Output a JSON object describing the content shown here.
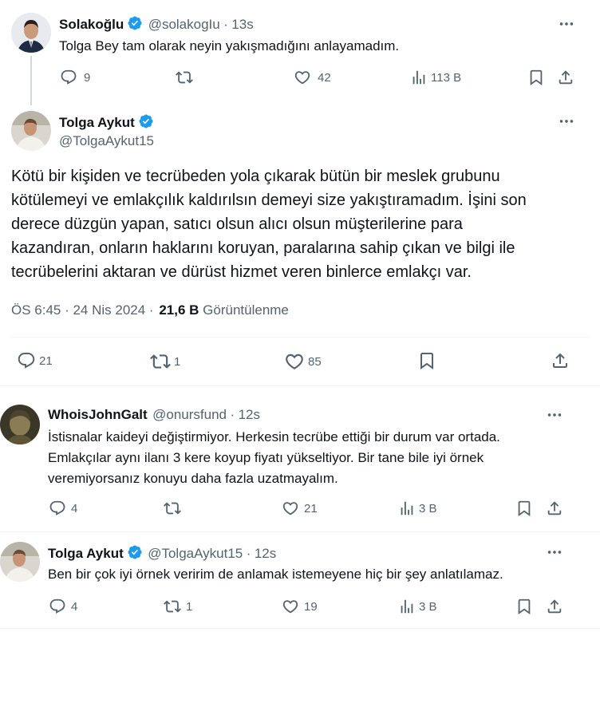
{
  "tweet1": {
    "name": "Solakoğlu",
    "handle": "@solakogIu",
    "sep": "·",
    "time": "13s",
    "text": "Tolga Bey tam olarak neyin yakışmadığını anlayamadım.",
    "replies": "9",
    "likes": "42",
    "views": "113 B"
  },
  "main": {
    "name": "Tolga Aykut",
    "handle": "@TolgaAykut15",
    "lines": [
      "Kötü bir kişiden ve tecrübeden yola çıkarak bütün bir meslek grubunu",
      "kötülemeyi ve emlakçılık kaldırılsın demeyi size yakıştıramadım. İşini son",
      "derece düzgün yapan, satıcı olsun alıcı olsun müşterilerine para",
      "kazandıran, onların haklarını koruyan, paralarına sahip çıkan ve bilgi ile",
      "tecrübelerini aktaran ve dürüst hizmet veren binlerce emlakçı var."
    ],
    "timestamp": "ÖS 6:45 · 24 Nis 2024 ·",
    "views_count": "21,6 B",
    "views_label": "Görüntülenme",
    "replies": "21",
    "retweets": "1",
    "likes": "85"
  },
  "reply1": {
    "name": "WhoisJohnGalt",
    "handle": "@onursfund",
    "sep": "·",
    "time": "12s",
    "lines": [
      "İstisnalar kaideyi değiştirmiyor. Herkesin tecrübe ettiği bir durum var ortada.",
      "Emlakçılar aynı ilanı 3 kere koyup fiyatı yükseltiyor. Bir tane bile iyi örnek",
      "veremiyorsanız konuyu daha fazla uzatmayalım."
    ],
    "replies": "4",
    "likes": "21",
    "views": "3 B"
  },
  "reply2": {
    "name": "Tolga Aykut",
    "handle": "@TolgaAykut15",
    "sep": "·",
    "time": "12s",
    "text": "Ben bir çok iyi örnek veririm de anlamak istemeyene hiç bir şey anlatılamaz.",
    "replies": "4",
    "retweets": "1",
    "likes": "19",
    "views": "3 B"
  },
  "icons": [
    "more-icon",
    "verified-badge-icon",
    "reply-icon",
    "retweet-icon",
    "like-icon",
    "views-icon",
    "bookmark-icon",
    "share-icon"
  ],
  "colors": {
    "verified": "#1d9bf0",
    "muted": "#536471",
    "text": "#0f1419"
  }
}
